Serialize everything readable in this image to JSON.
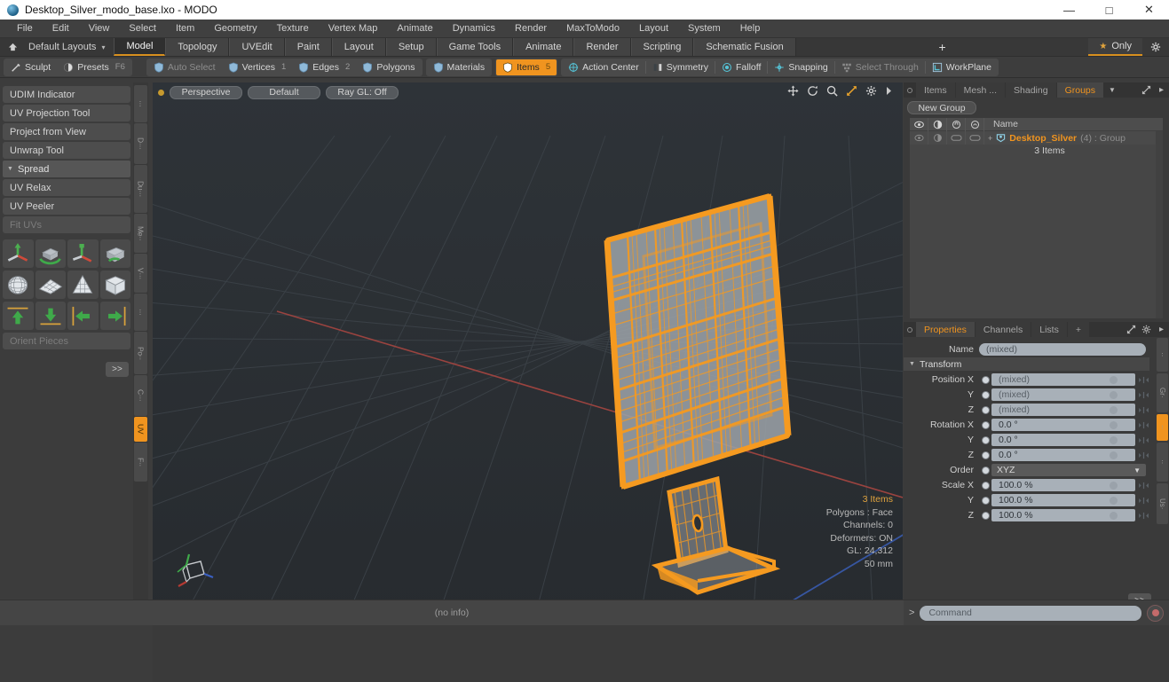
{
  "window": {
    "title": "Desktop_Silver_modo_base.lxo - MODO",
    "app_icon": "modo-sphere-icon",
    "minimize": "—",
    "maximize": "□",
    "close": "✕"
  },
  "menubar": {
    "items": [
      "File",
      "Edit",
      "View",
      "Select",
      "Item",
      "Geometry",
      "Texture",
      "Vertex Map",
      "Animate",
      "Dynamics",
      "Render",
      "MaxToModo",
      "Layout",
      "System",
      "Help"
    ]
  },
  "layoutbar": {
    "home_icon": "home-icon",
    "layouts_label": "Default Layouts",
    "caret": "▾",
    "tabs": [
      {
        "label": "Model",
        "active": true
      },
      {
        "label": "Topology",
        "active": false
      },
      {
        "label": "UVEdit",
        "active": false
      },
      {
        "label": "Paint",
        "active": false
      },
      {
        "label": "Layout",
        "active": false
      },
      {
        "label": "Setup",
        "active": false
      },
      {
        "label": "Game Tools",
        "active": false
      },
      {
        "label": "Animate",
        "active": false
      },
      {
        "label": "Render",
        "active": false
      },
      {
        "label": "Scripting",
        "active": false
      },
      {
        "label": "Schematic Fusion",
        "active": false
      }
    ],
    "add_tab": "+",
    "only_label": "Only",
    "star_icon": "star-icon",
    "gear_icon": "gear-icon"
  },
  "modebar": {
    "left_group": [
      {
        "label": "Sculpt",
        "icon": "brush-icon",
        "state": "normal",
        "badge": ""
      },
      {
        "label": "Presets",
        "icon": "sphere-icon",
        "state": "normal",
        "badge": "F6"
      }
    ],
    "select_group": [
      {
        "label": "Auto Select",
        "icon": "shield-icon",
        "state": "dim",
        "badge": ""
      },
      {
        "label": "Vertices",
        "icon": "shield-icon",
        "state": "normal",
        "badge": "1"
      },
      {
        "label": "Edges",
        "icon": "shield-icon",
        "state": "normal",
        "badge": "2"
      },
      {
        "label": "Polygons",
        "icon": "shield-icon",
        "state": "normal",
        "badge": ""
      }
    ],
    "mat_group": [
      {
        "label": "Materials",
        "icon": "shield-icon",
        "state": "normal",
        "badge": ""
      }
    ],
    "items_group": [
      {
        "label": "Items",
        "icon": "shield-icon",
        "state": "selected",
        "badge": "5"
      }
    ],
    "right_group": [
      {
        "label": "Action Center",
        "icon": "target-icon",
        "state": "normal",
        "badge": ""
      },
      {
        "label": "Symmetry",
        "icon": "symmetry-icon",
        "state": "normal",
        "badge": ""
      },
      {
        "label": "Falloff",
        "icon": "falloff-icon",
        "state": "normal",
        "badge": ""
      },
      {
        "label": "Snapping",
        "icon": "snap-icon",
        "state": "normal",
        "badge": ""
      },
      {
        "label": "Select Through",
        "icon": "through-icon",
        "state": "dim",
        "badge": ""
      },
      {
        "label": "WorkPlane",
        "icon": "workplane-icon",
        "state": "normal",
        "badge": ""
      }
    ]
  },
  "leftpanel": {
    "rows": [
      {
        "label": "UDIM Indicator",
        "type": "row",
        "dim": false
      },
      {
        "label": "UV Projection Tool",
        "type": "row",
        "dim": false
      },
      {
        "label": "Project from View",
        "type": "row",
        "dim": false
      },
      {
        "label": "Unwrap Tool",
        "type": "row",
        "dim": false
      },
      {
        "label": "Spread",
        "type": "head",
        "dim": false
      },
      {
        "label": "UV Relax",
        "type": "row",
        "dim": false
      },
      {
        "label": "UV Peeler",
        "type": "row",
        "dim": false
      },
      {
        "label": "Fit UVs",
        "type": "row",
        "dim": true
      }
    ],
    "icon_rows": [
      [
        "uv-move-icon",
        "uv-rotate-icon",
        "uv-scale-icon",
        "uv-flip-icon"
      ],
      [
        "uv-sphere-icon",
        "uv-plane-icon",
        "uv-cone-icon",
        "uv-cube-icon"
      ],
      [
        "align-up-icon",
        "align-down-icon",
        "align-left-icon",
        "align-right-icon"
      ]
    ],
    "orient_label": "Orient Pieces",
    "more_label": ">>",
    "vtabs": [
      "···",
      "D···",
      "Du···",
      "Me··",
      "V···",
      "···",
      "Po··",
      "C···",
      "UV",
      "F··"
    ],
    "vtab_active_index": 8
  },
  "viewport": {
    "mode_label": "Perspective",
    "shading_label": "Default",
    "raygl_label": "Ray GL: Off",
    "icons": [
      "move-icon",
      "rotate-icon",
      "zoom-icon",
      "fit-icon",
      "gear-icon",
      "arrow-right-icon"
    ],
    "info": {
      "items": "3 Items",
      "polygons": "Polygons : Face",
      "channels": "Channels: 0",
      "deformers": "Deformers: ON",
      "gl": "GL: 24,312",
      "units": "50 mm"
    },
    "gizmo": "axis-gizmo",
    "model_color": "#f59a20",
    "bg_color": "#2b2f33"
  },
  "rightpanel": {
    "top_tabs": [
      {
        "label": "Items",
        "active": false
      },
      {
        "label": "Mesh ...",
        "active": false
      },
      {
        "label": "Shading",
        "active": false
      },
      {
        "label": "Groups",
        "active": true
      }
    ],
    "new_group_label": "New Group",
    "tree": {
      "name_header": "Name",
      "col_icons": [
        "eye-icon",
        "render-icon",
        "lock-icon",
        "select-icon"
      ],
      "row": {
        "expander": "+",
        "item_icon": "group-icon",
        "name": "Desktop_Silver",
        "meta": "(4) : Group"
      },
      "subrow": "3 Items"
    },
    "prop_tabs": [
      {
        "label": "Properties",
        "active": true
      },
      {
        "label": "Channels",
        "active": false
      },
      {
        "label": "Lists",
        "active": false
      },
      {
        "label": "+",
        "active": false
      }
    ],
    "name_label": "Name",
    "name_value": "(mixed)",
    "transform_section": "Transform",
    "fields": [
      {
        "label": "Position X",
        "value": "(mixed)",
        "grey": true
      },
      {
        "label": "Y",
        "value": "(mixed)",
        "grey": true
      },
      {
        "label": "Z",
        "value": "(mixed)",
        "grey": true
      },
      {
        "label": "Rotation X",
        "value": "0.0 °",
        "grey": false
      },
      {
        "label": "Y",
        "value": "0.0 °",
        "grey": false
      },
      {
        "label": "Z",
        "value": "0.0 °",
        "grey": false
      }
    ],
    "order_label": "Order",
    "order_value": "XYZ",
    "scale_fields": [
      {
        "label": "Scale X",
        "value": "100.0 %",
        "grey": false
      },
      {
        "label": "Y",
        "value": "100.0 %",
        "grey": false
      },
      {
        "label": "Z",
        "value": "100.0 %",
        "grey": false
      }
    ],
    "more_label": ">>",
    "side_tabs": [
      "··",
      "Gr·",
      "··",
      "··",
      "Us·"
    ]
  },
  "bottom": {
    "status": "(no info)",
    "cmd_prompt": ">",
    "cmd_placeholder": "Command",
    "record_icon": "record-icon"
  }
}
